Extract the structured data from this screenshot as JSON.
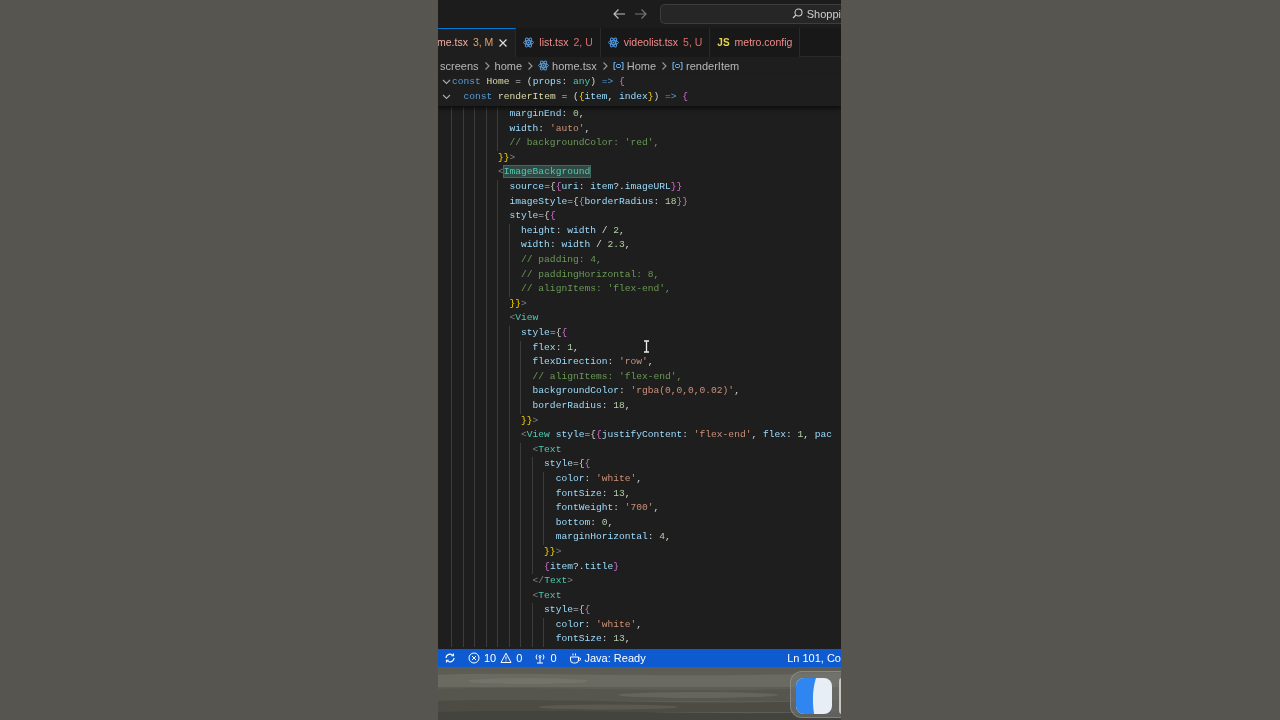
{
  "title_bar": {
    "search": {
      "value": "Shoppi"
    }
  },
  "tabs": [
    {
      "name": "me.tsx",
      "status": "3, M",
      "kind": "plain",
      "selected": true
    },
    {
      "name": "list.tsx",
      "status": "2, U",
      "kind": "react",
      "selected": false
    },
    {
      "name": "videolist.tsx",
      "status": "5, U",
      "kind": "react",
      "selected": false
    },
    {
      "name": "metro.config",
      "kind": "js",
      "icon_text": "JS",
      "selected": false
    }
  ],
  "breadcrumbs": [
    {
      "text": "screens",
      "kind": "folder"
    },
    {
      "text": "home",
      "kind": "folder"
    },
    {
      "text": "home.tsx",
      "kind": "react"
    },
    {
      "text": "Home",
      "kind": "symbol"
    },
    {
      "text": "renderItem",
      "kind": "symbol"
    }
  ],
  "sticky_lines": [
    {
      "expanded": true,
      "tokens": [
        {
          "text": "const",
          "kind": "kw"
        },
        {
          "text": " Home",
          "kind": "fn"
        },
        {
          "text": " = (",
          "kind": "plain"
        },
        {
          "text": "props",
          "kind": "var"
        },
        {
          "text": ": ",
          "kind": "plain"
        },
        {
          "text": "any",
          "kind": "type"
        },
        {
          "text": ") ",
          "kind": "plain"
        },
        {
          "text": "=>",
          "kind": "kw"
        },
        {
          "text": " {",
          "kind": "brace"
        }
      ]
    },
    {
      "expanded": true,
      "tokens": [
        {
          "text": "  const",
          "kind": "kw"
        },
        {
          "text": " renderItem",
          "kind": "fn"
        },
        {
          "text": " = (",
          "kind": "plain"
        },
        {
          "text": "{",
          "kind": "brace2"
        },
        {
          "text": "item",
          "kind": "var"
        },
        {
          "text": ", ",
          "kind": "plain"
        },
        {
          "text": "index",
          "kind": "var"
        },
        {
          "text": "}",
          "kind": "brace2"
        },
        {
          "text": ") ",
          "kind": "plain"
        },
        {
          "text": "=>",
          "kind": "kw"
        },
        {
          "text": " {",
          "kind": "brace"
        }
      ]
    }
  ],
  "code_lines": [
    {
      "tokens": [
        {
          "text": "          marginEnd",
          "kind": "prop"
        },
        {
          "text": ": ",
          "kind": "plain"
        },
        {
          "text": "0",
          "kind": "num"
        },
        {
          "text": ",",
          "kind": "plain"
        }
      ]
    },
    {
      "tokens": [
        {
          "text": "          width",
          "kind": "prop"
        },
        {
          "text": ": ",
          "kind": "plain"
        },
        {
          "text": "'auto'",
          "kind": "str"
        },
        {
          "text": ",",
          "kind": "plain"
        }
      ]
    },
    {
      "tokens": [
        {
          "text": "          // backgroundColor: 'red',",
          "kind": "cmt"
        }
      ]
    },
    {
      "tokens": [
        {
          "text": "        }}",
          "kind": "brace2"
        },
        {
          "text": ">",
          "kind": "punct"
        }
      ]
    },
    {
      "tokens": [
        {
          "text": "        <",
          "kind": "punct"
        },
        {
          "text": "ImageBackground",
          "kind": "tag_match"
        }
      ]
    },
    {
      "tokens": [
        {
          "text": "          source",
          "kind": "prop"
        },
        {
          "text": "={",
          "kind": "plain"
        },
        {
          "text": "{",
          "kind": "brace"
        },
        {
          "text": "uri",
          "kind": "prop"
        },
        {
          "text": ": ",
          "kind": "plain"
        },
        {
          "text": "item",
          "kind": "var"
        },
        {
          "text": "?.",
          "kind": "plain"
        },
        {
          "text": "imageURL",
          "kind": "prop"
        },
        {
          "text": "}}",
          "kind": "brace"
        }
      ]
    },
    {
      "tokens": [
        {
          "text": "          imageStyle",
          "kind": "prop"
        },
        {
          "text": "={",
          "kind": "plain"
        },
        {
          "text": "{",
          "kind": "brace"
        },
        {
          "text": "borderRadius",
          "kind": "prop"
        },
        {
          "text": ": ",
          "kind": "plain"
        },
        {
          "text": "18",
          "kind": "num"
        },
        {
          "text": "}}",
          "kind": "brace"
        }
      ]
    },
    {
      "tokens": [
        {
          "text": "          style",
          "kind": "prop"
        },
        {
          "text": "={",
          "kind": "plain"
        },
        {
          "text": "{",
          "kind": "brace"
        }
      ]
    },
    {
      "tokens": [
        {
          "text": "            height",
          "kind": "prop"
        },
        {
          "text": ": ",
          "kind": "plain"
        },
        {
          "text": "width",
          "kind": "var"
        },
        {
          "text": " / ",
          "kind": "plain"
        },
        {
          "text": "2",
          "kind": "num"
        },
        {
          "text": ",",
          "kind": "plain"
        }
      ]
    },
    {
      "tokens": [
        {
          "text": "            width",
          "kind": "prop"
        },
        {
          "text": ": ",
          "kind": "plain"
        },
        {
          "text": "width",
          "kind": "var"
        },
        {
          "text": " / ",
          "kind": "plain"
        },
        {
          "text": "2.3",
          "kind": "num"
        },
        {
          "text": ",",
          "kind": "plain"
        }
      ]
    },
    {
      "tokens": [
        {
          "text": "            // padding: 4,",
          "kind": "cmt"
        }
      ]
    },
    {
      "tokens": [
        {
          "text": "            // paddingHorizontal: 8,",
          "kind": "cmt"
        }
      ]
    },
    {
      "tokens": [
        {
          "text": "            // alignItems: 'flex-end',",
          "kind": "cmt"
        }
      ]
    },
    {
      "tokens": [
        {
          "text": "          }}",
          "kind": "brace2"
        },
        {
          "text": ">",
          "kind": "punct"
        }
      ]
    },
    {
      "tokens": [
        {
          "text": "          <",
          "kind": "punct"
        },
        {
          "text": "View",
          "kind": "tag"
        }
      ]
    },
    {
      "tokens": [
        {
          "text": "            style",
          "kind": "prop"
        },
        {
          "text": "={",
          "kind": "plain"
        },
        {
          "text": "{",
          "kind": "brace"
        }
      ]
    },
    {
      "tokens": [
        {
          "text": "              flex",
          "kind": "prop"
        },
        {
          "text": ": ",
          "kind": "plain"
        },
        {
          "text": "1",
          "kind": "num"
        },
        {
          "text": ",",
          "kind": "plain"
        }
      ]
    },
    {
      "tokens": [
        {
          "text": "              flexDirection",
          "kind": "prop"
        },
        {
          "text": ": ",
          "kind": "plain"
        },
        {
          "text": "'row'",
          "kind": "str"
        },
        {
          "text": ",",
          "kind": "plain"
        }
      ]
    },
    {
      "tokens": [
        {
          "text": "              // alignItems: 'flex-end',",
          "kind": "cmt"
        }
      ]
    },
    {
      "tokens": [
        {
          "text": "              backgroundColor",
          "kind": "prop"
        },
        {
          "text": ": ",
          "kind": "plain"
        },
        {
          "text": "'rgba(0,0,0,0.02)'",
          "kind": "str"
        },
        {
          "text": ",",
          "kind": "plain"
        }
      ]
    },
    {
      "tokens": [
        {
          "text": "              borderRadius",
          "kind": "prop"
        },
        {
          "text": ": ",
          "kind": "plain"
        },
        {
          "text": "18",
          "kind": "num"
        },
        {
          "text": ",",
          "kind": "plain"
        }
      ]
    },
    {
      "tokens": [
        {
          "text": "            }}",
          "kind": "brace2"
        },
        {
          "text": ">",
          "kind": "punct"
        }
      ]
    },
    {
      "tokens": [
        {
          "text": "            <",
          "kind": "punct"
        },
        {
          "text": "View",
          "kind": "tag"
        },
        {
          "text": " style",
          "kind": "prop"
        },
        {
          "text": "={",
          "kind": "plain"
        },
        {
          "text": "{",
          "kind": "brace"
        },
        {
          "text": "justifyContent",
          "kind": "prop"
        },
        {
          "text": ": ",
          "kind": "plain"
        },
        {
          "text": "'flex-end'",
          "kind": "str"
        },
        {
          "text": ", ",
          "kind": "plain"
        },
        {
          "text": "flex",
          "kind": "prop"
        },
        {
          "text": ": ",
          "kind": "plain"
        },
        {
          "text": "1",
          "kind": "num"
        },
        {
          "text": ", ",
          "kind": "plain"
        },
        {
          "text": "pac",
          "kind": "prop"
        }
      ]
    },
    {
      "tokens": [
        {
          "text": "              <",
          "kind": "punct"
        },
        {
          "text": "Text",
          "kind": "tag"
        }
      ]
    },
    {
      "tokens": [
        {
          "text": "                style",
          "kind": "prop"
        },
        {
          "text": "={",
          "kind": "plain"
        },
        {
          "text": "{",
          "kind": "brace"
        }
      ]
    },
    {
      "tokens": [
        {
          "text": "                  color",
          "kind": "prop"
        },
        {
          "text": ": ",
          "kind": "plain"
        },
        {
          "text": "'white'",
          "kind": "str"
        },
        {
          "text": ",",
          "kind": "plain"
        }
      ]
    },
    {
      "tokens": [
        {
          "text": "                  fontSize",
          "kind": "prop"
        },
        {
          "text": ": ",
          "kind": "plain"
        },
        {
          "text": "13",
          "kind": "num"
        },
        {
          "text": ",",
          "kind": "plain"
        }
      ]
    },
    {
      "tokens": [
        {
          "text": "                  fontWeight",
          "kind": "prop"
        },
        {
          "text": ": ",
          "kind": "plain"
        },
        {
          "text": "'700'",
          "kind": "str"
        },
        {
          "text": ",",
          "kind": "plain"
        }
      ]
    },
    {
      "tokens": [
        {
          "text": "                  bottom",
          "kind": "prop"
        },
        {
          "text": ": ",
          "kind": "plain"
        },
        {
          "text": "0",
          "kind": "num"
        },
        {
          "text": ",",
          "kind": "plain"
        }
      ]
    },
    {
      "tokens": [
        {
          "text": "                  marginHorizontal",
          "kind": "prop"
        },
        {
          "text": ": ",
          "kind": "plain"
        },
        {
          "text": "4",
          "kind": "num"
        },
        {
          "text": ",",
          "kind": "plain"
        }
      ]
    },
    {
      "tokens": [
        {
          "text": "                }}",
          "kind": "brace2"
        },
        {
          "text": ">",
          "kind": "punct"
        }
      ]
    },
    {
      "tokens": [
        {
          "text": "                {",
          "kind": "brace"
        },
        {
          "text": "item",
          "kind": "var"
        },
        {
          "text": "?.",
          "kind": "plain"
        },
        {
          "text": "title",
          "kind": "prop"
        },
        {
          "text": "}",
          "kind": "brace"
        }
      ]
    },
    {
      "tokens": [
        {
          "text": "              </",
          "kind": "punct"
        },
        {
          "text": "Text",
          "kind": "tag"
        },
        {
          "text": ">",
          "kind": "punct"
        }
      ]
    },
    {
      "tokens": [
        {
          "text": "              <",
          "kind": "punct"
        },
        {
          "text": "Text",
          "kind": "tag"
        }
      ]
    },
    {
      "tokens": [
        {
          "text": "                style",
          "kind": "prop"
        },
        {
          "text": "={",
          "kind": "plain"
        },
        {
          "text": "{",
          "kind": "brace"
        }
      ]
    },
    {
      "tokens": [
        {
          "text": "                  color",
          "kind": "prop"
        },
        {
          "text": ": ",
          "kind": "plain"
        },
        {
          "text": "'white'",
          "kind": "str"
        },
        {
          "text": ",",
          "kind": "plain"
        }
      ]
    },
    {
      "tokens": [
        {
          "text": "                  fontSize",
          "kind": "prop"
        },
        {
          "text": ": ",
          "kind": "plain"
        },
        {
          "text": "13",
          "kind": "num"
        },
        {
          "text": ",",
          "kind": "plain"
        }
      ]
    }
  ],
  "status_bar": {
    "left": [
      {
        "kind": "sync"
      },
      {
        "kind": "problems",
        "errors": "10",
        "warnings": "0"
      },
      {
        "kind": "ports",
        "text": "0"
      },
      {
        "kind": "java",
        "text": "Java: Ready"
      }
    ],
    "right": [
      {
        "kind": "position",
        "text": "Ln 101, Co"
      }
    ]
  }
}
